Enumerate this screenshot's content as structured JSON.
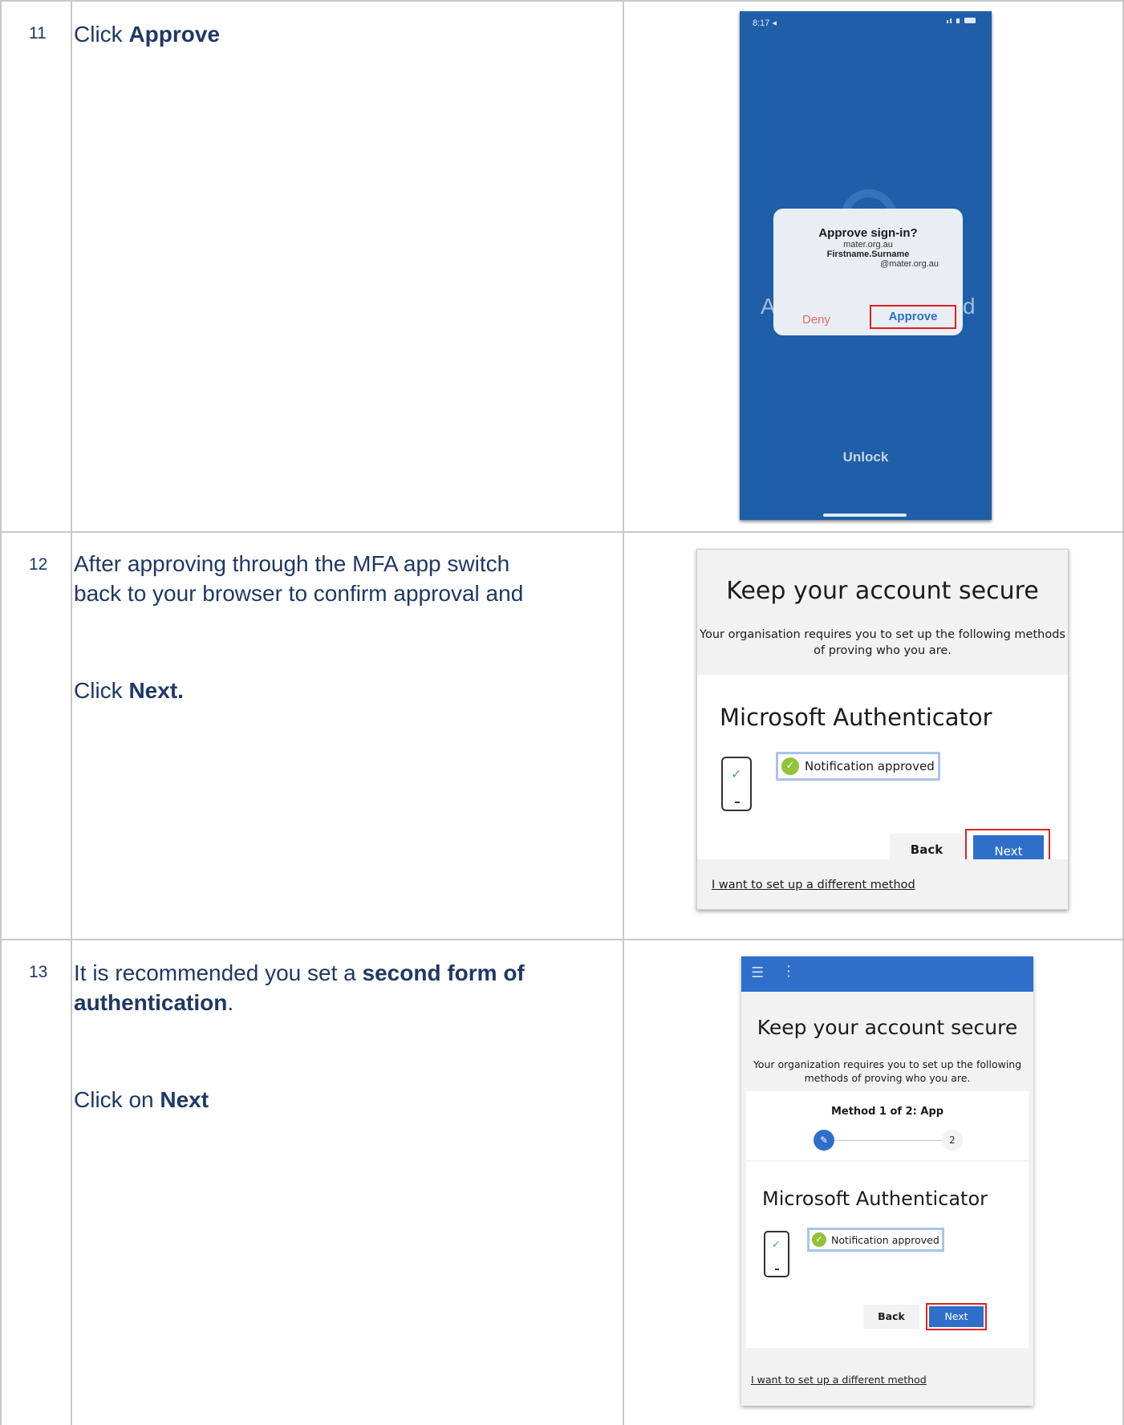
{
  "steps": [
    {
      "number": "11",
      "line1_prefix": "Click ",
      "line1_bold": "Approve",
      "phone": {
        "status_time": "8:17 ◂",
        "dialog_title": "Approve sign-in?",
        "dialog_org": "mater.org.au",
        "dialog_user": "Firstname.Surname",
        "dialog_domain": "@mater.org.au",
        "deny_label": "Deny",
        "approve_label": "Approve",
        "bg_left": "A",
        "bg_right": "d",
        "unlock_label": "Unlock"
      }
    },
    {
      "number": "12",
      "text_line1": "After approving through the MFA app switch",
      "text_line2": "back to your browser to confirm approval and",
      "click_prefix": "Click ",
      "click_bold": "Next.",
      "screenshot": {
        "title": "Keep your account secure",
        "subtitle_line1": "Your organisation requires you to set up the following methods",
        "subtitle_line2": "of proving who you are.",
        "method_title": "Microsoft Authenticator",
        "notification": "Notification approved",
        "back_label": "Back",
        "next_label": "Next",
        "alt_method_link": "I want to set up a different method"
      }
    },
    {
      "number": "13",
      "text_prefix": "It is recommended you set a ",
      "text_bold1": "second form of",
      "text_bold2": "authentication",
      "text_suffix": ".",
      "click_prefix": "Click on ",
      "click_bold": "Next",
      "screenshot": {
        "title": "Keep your account secure",
        "subtitle_line1": "Your organization requires you to set up the following",
        "subtitle_line2": "methods of proving who you are.",
        "method_progress": "Method 1 of 2: App",
        "step2_label": "2",
        "method_title": "Microsoft Authenticator",
        "notification": "Notification approved",
        "back_label": "Back",
        "next_label": "Next",
        "alt_method_link": "I want to set up a different method"
      }
    }
  ],
  "colors": {
    "text": "#1f3864",
    "phone_bg": "#1f5fa8",
    "button_blue": "#2f6fc9",
    "highlight_red": "#dd2222",
    "check_green": "#92c13a"
  },
  "icons": [
    "pencil-icon",
    "check-icon",
    "hamburger-menu-icon",
    "more-vertical-icon",
    "lock-icon",
    "phone-icon"
  ]
}
